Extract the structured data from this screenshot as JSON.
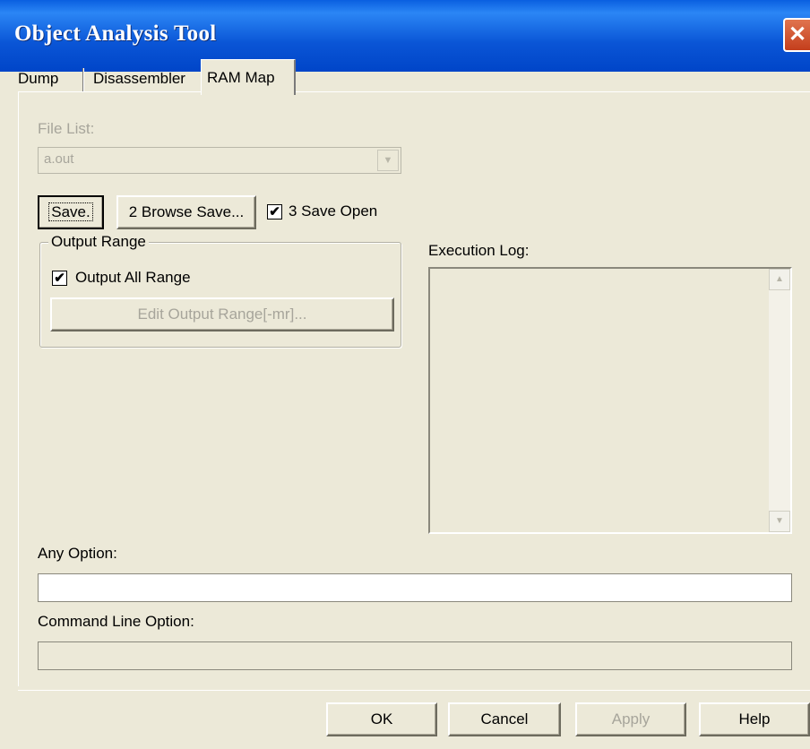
{
  "window": {
    "title": "Object Analysis Tool"
  },
  "tabs": [
    {
      "label": "Dump"
    },
    {
      "label": "Disassembler"
    },
    {
      "label": "RAM Map"
    }
  ],
  "file_list": {
    "label": "File List:",
    "value": "a.out"
  },
  "buttons": {
    "save": "Save.",
    "browse_save": "2 Browse Save...",
    "edit_output_range": "Edit Output Range[-mr]..."
  },
  "save_open": {
    "label": "3 Save Open",
    "checked": true
  },
  "output_range": {
    "group_title": "Output Range",
    "output_all_label": "Output All Range",
    "checked": true
  },
  "execution_log": {
    "label": "Execution Log:"
  },
  "any_option": {
    "label": "Any Option:",
    "value": ""
  },
  "command_line_option": {
    "label": "Command Line Option:",
    "value": ""
  },
  "footer": {
    "ok": "OK",
    "cancel": "Cancel",
    "apply": "Apply",
    "help": "Help"
  },
  "icons": {
    "close": "close-icon",
    "check": "check-icon",
    "dropdown": "chevron-down-icon",
    "scroll_up": "arrow-up-icon",
    "scroll_down": "arrow-down-icon"
  }
}
